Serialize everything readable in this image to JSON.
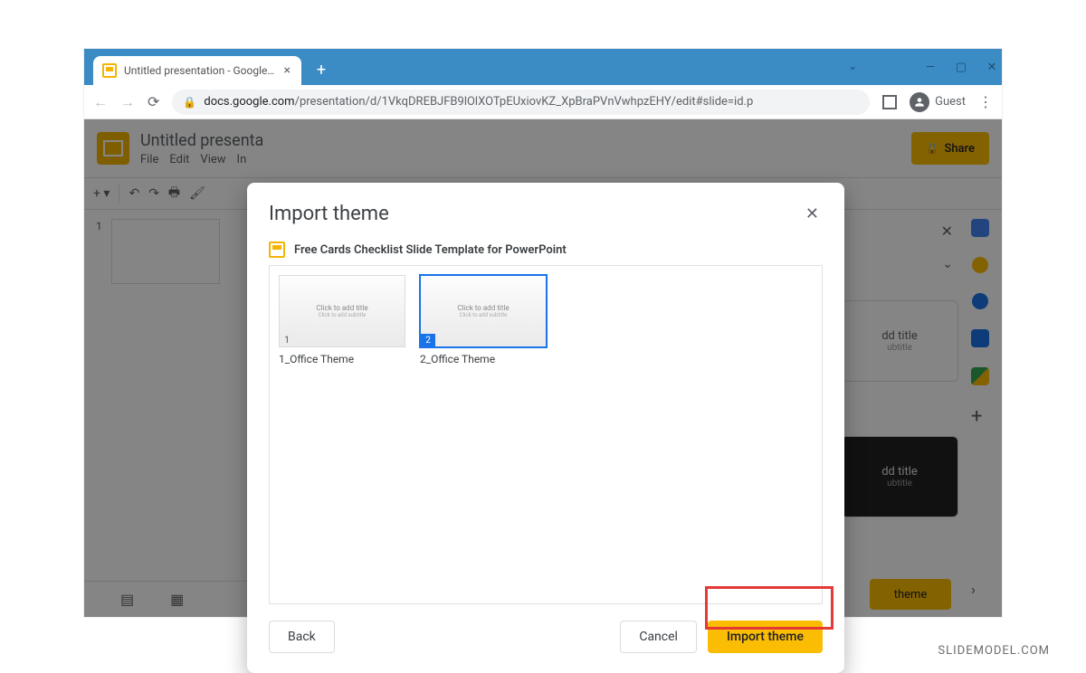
{
  "browser": {
    "tab_title": "Untitled presentation - Google Sl",
    "url_host": "docs.google.com",
    "url_path": "/presentation/d/1VkqDREBJFB9lOlXOTpEUxiovKZ_XpBraPVnVwhpzEHY/edit#slide=id.p",
    "guest_label": "Guest"
  },
  "app": {
    "doc_title": "Untitled presenta",
    "menus": [
      "File",
      "Edit",
      "View",
      "In"
    ],
    "share_label": "Share",
    "thumb_number": "1",
    "themes": {
      "card1_title": "dd title",
      "card1_sub": "ubtitle",
      "card2_title": "dd title",
      "card2_sub": "ubtitle",
      "import_btn": "theme"
    }
  },
  "modal": {
    "title": "Import theme",
    "file_name": "Free Cards Checklist Slide Template for PowerPoint",
    "items": [
      {
        "num": "1",
        "label": "1_Office Theme",
        "thumb_text": "Click to add title",
        "thumb_sub": "Click to add subtitle",
        "selected": false
      },
      {
        "num": "2",
        "label": "2_Office Theme",
        "thumb_text": "Click to add title",
        "thumb_sub": "Click to add subtitle",
        "selected": true
      }
    ],
    "back_label": "Back",
    "cancel_label": "Cancel",
    "import_label": "Import theme"
  },
  "watermark": "SLIDEMODEL.COM"
}
